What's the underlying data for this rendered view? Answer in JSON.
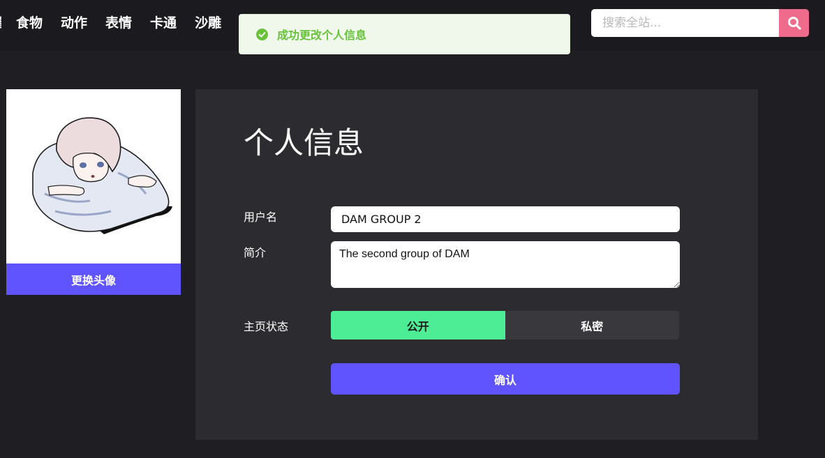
{
  "nav": {
    "items": [
      {
        "label": "图"
      },
      {
        "label": "食物"
      },
      {
        "label": "动作"
      },
      {
        "label": "表情"
      },
      {
        "label": "卡通"
      },
      {
        "label": "沙雕"
      }
    ]
  },
  "search": {
    "placeholder": "搜索全站...",
    "value": "",
    "icon": "search-icon",
    "button_color": "#ee6b8b"
  },
  "toast": {
    "message": "成功更改个人信息",
    "icon": "check-circle-icon",
    "color": "#67c23a"
  },
  "avatar": {
    "change_label": "更换头像",
    "button_color": "#5f54ff"
  },
  "profile": {
    "title": "个人信息",
    "username_label": "用户名",
    "username_value": "DAM GROUP 2",
    "bio_label": "简介",
    "bio_value": "The second group of DAM",
    "status_label": "主页状态",
    "status_options": [
      "公开",
      "私密"
    ],
    "status_selected": "公开",
    "confirm_label": "确认",
    "accent_color": "#4ded96"
  }
}
